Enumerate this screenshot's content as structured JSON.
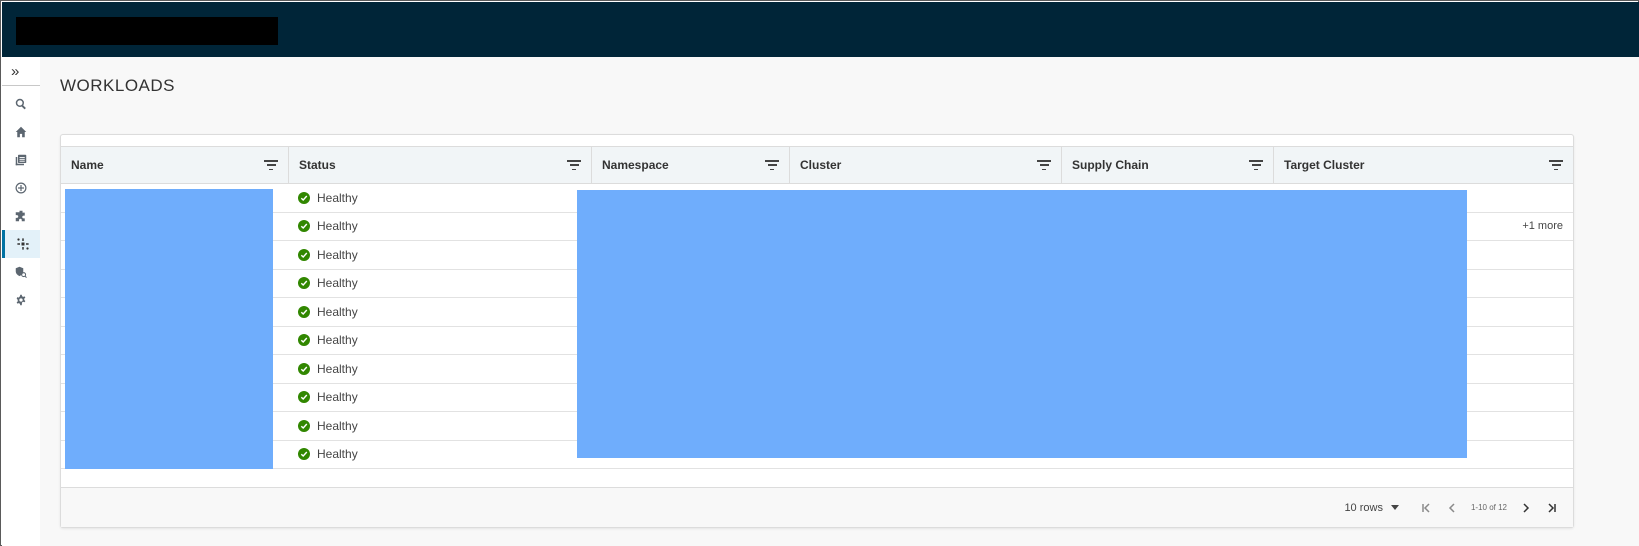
{
  "header": {
    "logo_redacted": true
  },
  "sidebar": {
    "expand_label": "»",
    "items": [
      {
        "icon": "search-icon"
      },
      {
        "icon": "home-icon"
      },
      {
        "icon": "catalog-icon"
      },
      {
        "icon": "add-circle-icon"
      },
      {
        "icon": "plugin-icon"
      },
      {
        "icon": "workloads-icon",
        "active": true
      },
      {
        "icon": "security-icon"
      },
      {
        "icon": "settings-icon"
      }
    ]
  },
  "page": {
    "title": "WORKLOADS"
  },
  "table": {
    "columns": [
      "Name",
      "Status",
      "Namespace",
      "Cluster",
      "Supply Chain",
      "Target Cluster"
    ],
    "rows": [
      {
        "status": "Healthy",
        "extra": ""
      },
      {
        "status": "Healthy",
        "extra": "+1 more"
      },
      {
        "status": "Healthy",
        "extra": ""
      },
      {
        "status": "Healthy",
        "extra": ""
      },
      {
        "status": "Healthy",
        "extra": ""
      },
      {
        "status": "Healthy",
        "extra": ""
      },
      {
        "status": "Healthy",
        "extra": ""
      },
      {
        "status": "Healthy",
        "extra": ""
      },
      {
        "status": "Healthy",
        "extra": ""
      },
      {
        "status": "Healthy",
        "extra": ""
      }
    ]
  },
  "pagination": {
    "rows_label": "10 rows",
    "range_label": "1-10 of 12"
  },
  "colors": {
    "topbar": "#002538",
    "healthy": "#318700",
    "redaction": "#6fadfc"
  }
}
